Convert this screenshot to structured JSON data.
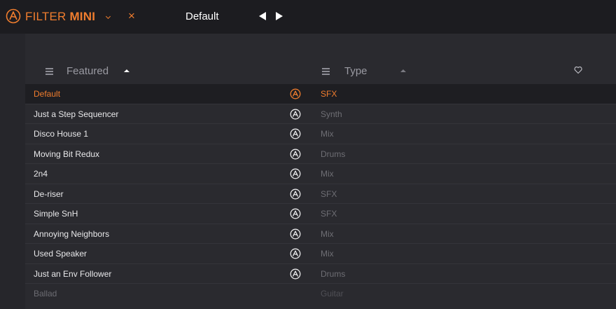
{
  "topbar": {
    "product_prefix": "FILTER ",
    "product_bold": "MINI",
    "close_symbol": "×",
    "preset_name": "Default",
    "icons": [
      "arturia-logo-icon",
      "dropdown-chevron-icon",
      "prev-arrow-icon",
      "next-arrow-icon"
    ]
  },
  "columns": {
    "featured_label": "Featured",
    "type_label": "Type",
    "icons": [
      "hamburger-icon",
      "sort-up-icon",
      "heart-icon"
    ]
  },
  "presets": [
    {
      "name": "Default",
      "type": "SFX"
    },
    {
      "name": "Just a Step Sequencer",
      "type": "Synth"
    },
    {
      "name": "Disco House 1",
      "type": "Mix"
    },
    {
      "name": "Moving Bit Redux",
      "type": "Drums"
    },
    {
      "name": "2n4",
      "type": "Mix"
    },
    {
      "name": "De-riser",
      "type": "SFX"
    },
    {
      "name": "Simple SnH",
      "type": "SFX"
    },
    {
      "name": "Annoying Neighbors",
      "type": "Mix"
    },
    {
      "name": "Used Speaker",
      "type": "Mix"
    },
    {
      "name": "Just an Env Follower",
      "type": "Drums"
    },
    {
      "name": "Ballad",
      "type": "Guitar"
    }
  ],
  "colors": {
    "accent": "#f07d2e",
    "background": "#2a2a2f",
    "topbar": "#1c1c20"
  }
}
